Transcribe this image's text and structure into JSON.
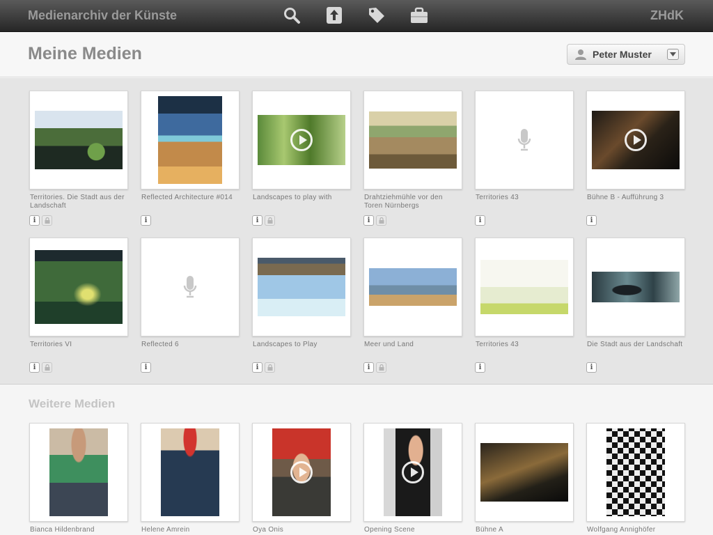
{
  "app": {
    "title": "Medienarchiv der Künste",
    "brand": "ZHdK"
  },
  "toolbar": {
    "icons": [
      "search-icon",
      "upload-icon",
      "tag-icon",
      "briefcase-icon"
    ]
  },
  "header": {
    "title": "Meine Medien",
    "user_name": "Peter Muster"
  },
  "my_media": {
    "items": [
      {
        "caption": "Territories. Die Stadt aus der Landschaft",
        "type": "image",
        "lock": true
      },
      {
        "caption": "Reflected Architecture #014",
        "type": "image",
        "lock": false
      },
      {
        "caption": "Landscapes to play with",
        "type": "video",
        "lock": true
      },
      {
        "caption": "Drahtziehmühle vor den Toren Nürnbergs",
        "type": "image",
        "lock": true
      },
      {
        "caption": "Territories 43",
        "type": "audio",
        "lock": false
      },
      {
        "caption": "Bühne B - Aufführung 3",
        "type": "video",
        "lock": false
      },
      {
        "caption": "Territories VI",
        "type": "image",
        "lock": true
      },
      {
        "caption": "Reflected 6",
        "type": "audio",
        "lock": false
      },
      {
        "caption": "Landscapes to Play",
        "type": "image",
        "lock": true
      },
      {
        "caption": "Meer und Land",
        "type": "image",
        "lock": true
      },
      {
        "caption": "Territories 43",
        "type": "image",
        "lock": false
      },
      {
        "caption": "Die Stadt aus der Landschaft",
        "type": "image",
        "lock": false
      }
    ]
  },
  "further_media": {
    "title": "Weitere Medien",
    "items": [
      {
        "caption": "Bianca Hildenbrand",
        "type": "image"
      },
      {
        "caption": "Helene Amrein",
        "type": "image"
      },
      {
        "caption": "Oya Onis",
        "type": "video"
      },
      {
        "caption": "Opening Scene",
        "type": "video"
      },
      {
        "caption": "Bühne A",
        "type": "image"
      },
      {
        "caption": "Wolfgang Annighöfer",
        "type": "image"
      }
    ]
  },
  "badges": {
    "info": "i"
  }
}
